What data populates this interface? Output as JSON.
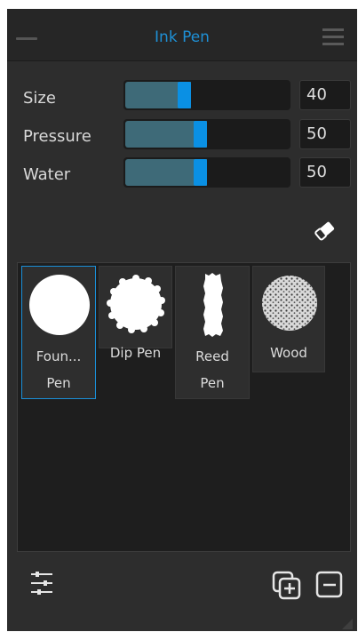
{
  "panel": {
    "title": "Ink Pen"
  },
  "settings": [
    {
      "label": "Size",
      "value": "40",
      "level": 0.4
    },
    {
      "label": "Pressure",
      "value": "50",
      "level": 0.5
    },
    {
      "label": "Water",
      "value": "50",
      "level": 0.5
    }
  ],
  "presets": [
    {
      "name": "Foun... Pen",
      "line1": "Foun...",
      "line2": "Pen",
      "icon": "round-brush-icon",
      "selected": true
    },
    {
      "name": "Dip Pen",
      "line1": "Dip Pen",
      "line2": "",
      "icon": "scalloped-brush-icon",
      "selected": false
    },
    {
      "name": "Reed Pen",
      "line1": "Reed",
      "line2": "Pen",
      "icon": "rough-bar-brush-icon",
      "selected": false
    },
    {
      "name": "Wood",
      "line1": "Wood",
      "line2": "",
      "icon": "textured-brush-icon",
      "selected": false
    }
  ],
  "colors": {
    "accent": "#0a90e4",
    "title": "#1e90d6",
    "panel": "#2d2d2d"
  },
  "icons": {
    "eraser": "eraser-icon",
    "settings": "sliders-icon",
    "duplicate": "duplicate-icon",
    "remove": "remove-icon",
    "menu": "menu-icon"
  }
}
